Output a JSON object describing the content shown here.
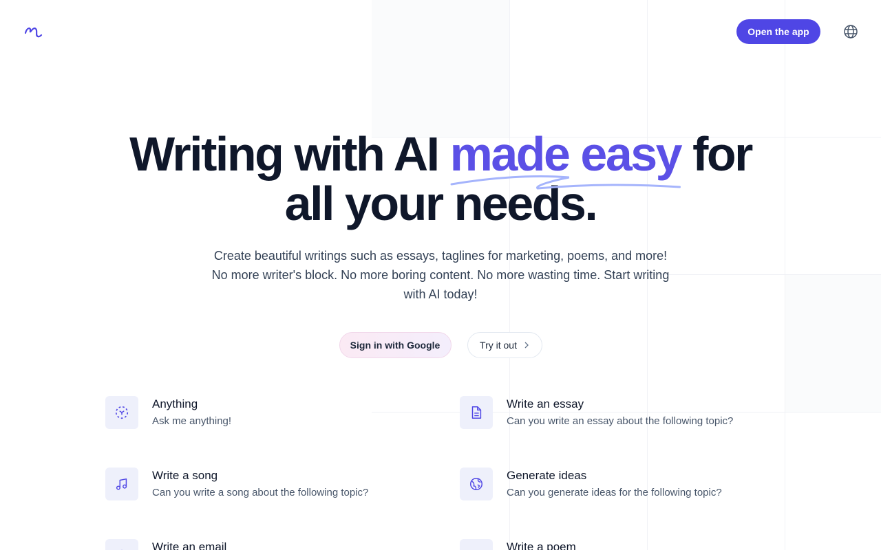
{
  "header": {
    "cta_label": "Open the app"
  },
  "hero": {
    "title_before": "Writing with AI ",
    "title_accent": "made easy",
    "title_after_line1": " for",
    "title_line2": "all your needs.",
    "subtitle": "Create beautiful writings such as essays, taglines for marketing, poems, and more! No more writer's block. No more boring content. No more wasting time. Start writing with AI today!"
  },
  "cta": {
    "google_label": "Sign in with Google",
    "try_label": "Try it out"
  },
  "features": [
    {
      "title": "Anything",
      "desc": "Ask me anything!",
      "icon": "scan-icon"
    },
    {
      "title": "Write an essay",
      "desc": "Can you write an essay about the following topic?",
      "icon": "document-icon"
    },
    {
      "title": "Write a song",
      "desc": "Can you write a song about the following topic?",
      "icon": "music-note-icon"
    },
    {
      "title": "Generate ideas",
      "desc": "Can you generate ideas for the following topic?",
      "icon": "globe-icon"
    },
    {
      "title": "Write an email",
      "desc": "",
      "icon": "email-icon"
    },
    {
      "title": "Write a poem",
      "desc": "",
      "icon": "pen-icon"
    }
  ],
  "colors": {
    "accent": "#4f46e5",
    "headline_accent": "#5b50e6",
    "text_dark": "#0f172a",
    "icon_bg": "#eef0fb"
  }
}
